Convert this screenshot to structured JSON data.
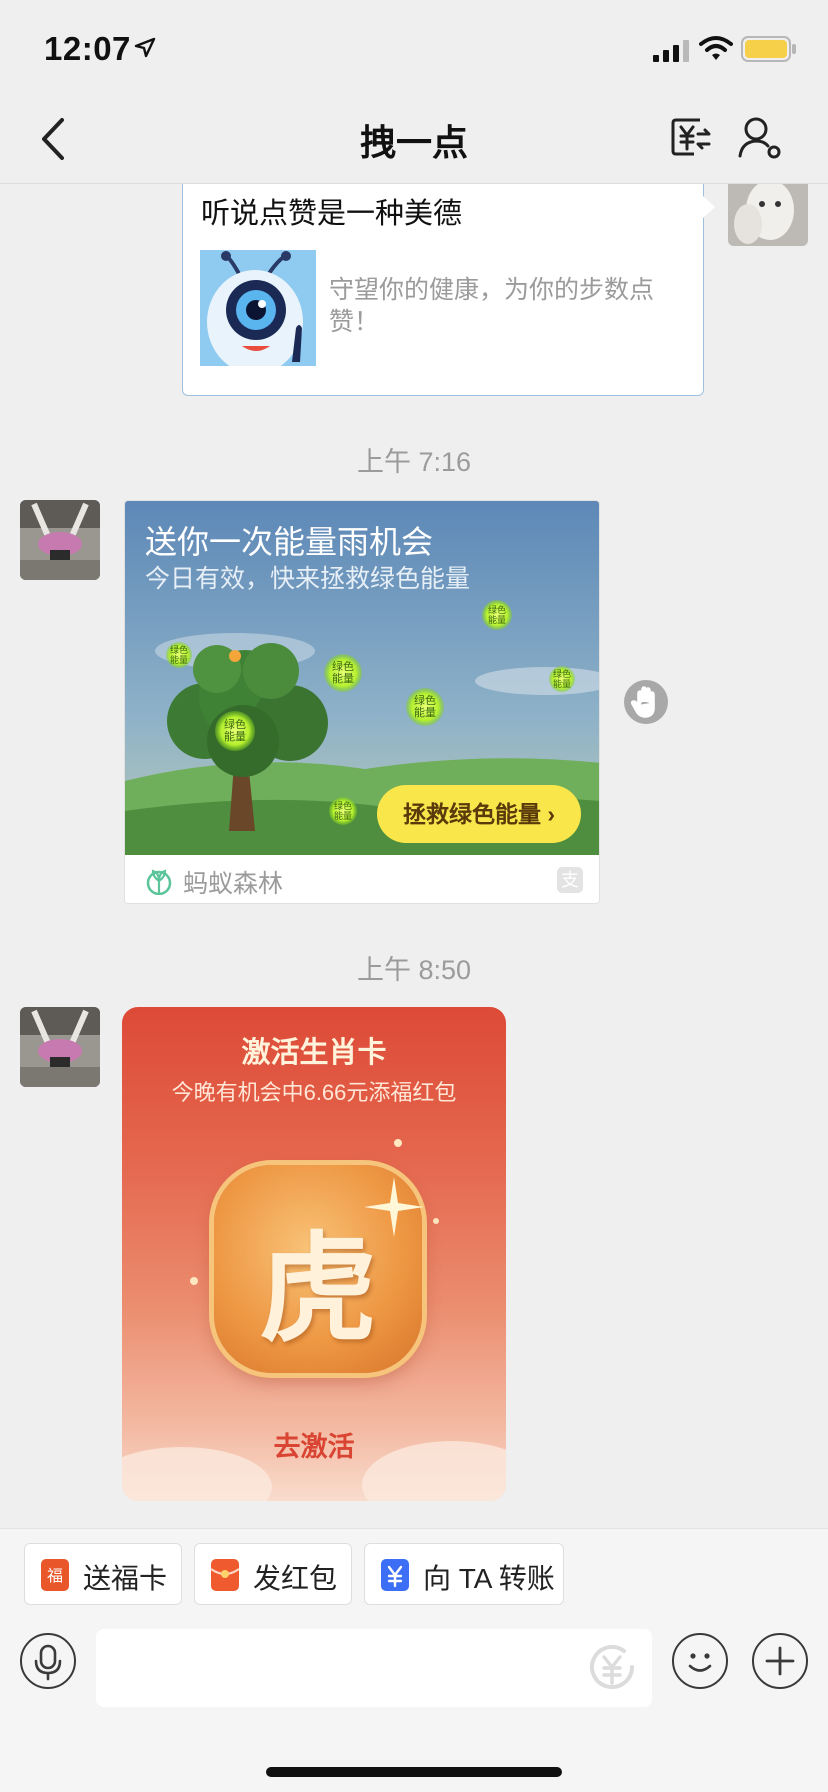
{
  "status_bar": {
    "time": "12:07"
  },
  "nav": {
    "title": "拽一点"
  },
  "messages": {
    "like_card": {
      "title": "听说点赞是一种美德",
      "description": "守望你的健康，为你的步数点赞！"
    },
    "timestamp_1": "上午 7:16",
    "energy_card": {
      "title": "送你一次能量雨机会",
      "subtitle": "今日有效，快来拯救绿色能量",
      "energy_ball_label": "绿色能量",
      "button": "拯救绿色能量",
      "source": "蚂蚁森林"
    },
    "timestamp_2": "上午 8:50",
    "zodiac_card": {
      "title": "激活生肖卡",
      "subtitle": "今晚有机会中6.66元添福红包",
      "character": "虎",
      "action": "去激活"
    }
  },
  "quick_actions": [
    {
      "label": "送福卡",
      "icon": "fu-card-icon",
      "color": "#e8562a"
    },
    {
      "label": "发红包",
      "icon": "red-envelope-icon",
      "color": "#ef5a2f"
    },
    {
      "label": "向 TA 转账",
      "icon": "transfer-yen-icon",
      "color": "#3c6ff5"
    }
  ],
  "input": {
    "placeholder": ""
  },
  "colors": {
    "background": "#efeff0",
    "card_border": "#9fc1e0",
    "energy_button": "#f8e64b",
    "zodiac_red": "#dd4a37",
    "battery": "#f7d04a"
  }
}
